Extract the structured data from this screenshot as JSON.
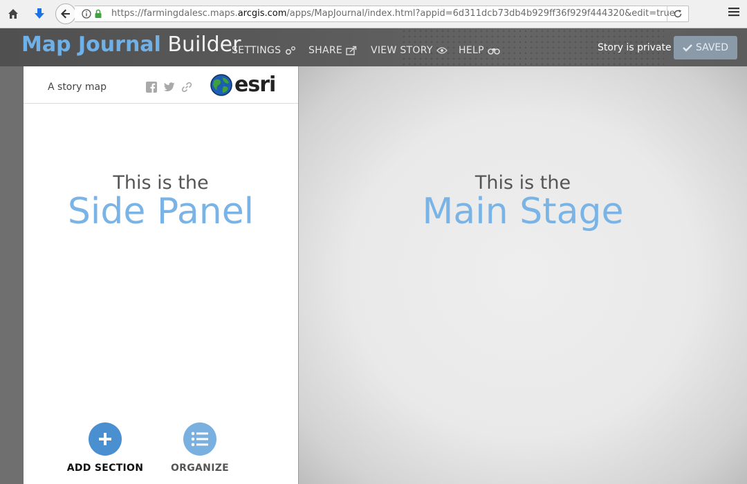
{
  "browser": {
    "url_prefix": "https://farmingdalesc.maps.",
    "url_host": "arcgis.com",
    "url_path": "/apps/MapJournal/index.html?appid=6d311dcb73db4b929ff36f929f444320&edit=true"
  },
  "header": {
    "brand_primary": "Map Journal",
    "brand_secondary": "Builder",
    "nav": [
      {
        "label": "SETTINGS",
        "icon": "gears-icon"
      },
      {
        "label": "SHARE",
        "icon": "share-icon"
      },
      {
        "label": "VIEW STORY",
        "icon": "eye-icon"
      },
      {
        "label": "HELP",
        "icon": "binoculars-icon"
      }
    ],
    "privacy_status": "Story is private",
    "saved_label": "SAVED"
  },
  "side_panel": {
    "tagline": "A story map",
    "logo_text": "esri",
    "placeholder_small": "This is the",
    "placeholder_big": "Side Panel",
    "actions": [
      {
        "label": "ADD SECTION",
        "icon": "plus-icon"
      },
      {
        "label": "ORGANIZE",
        "icon": "list-icon"
      }
    ]
  },
  "main_stage": {
    "placeholder_small": "This is the",
    "placeholder_big": "Main Stage"
  },
  "colors": {
    "accent_blue": "#7ab4e6",
    "add_button": "#4a8fd0",
    "organize_button": "#79b0df",
    "header_bg": "#5a5a5a"
  }
}
